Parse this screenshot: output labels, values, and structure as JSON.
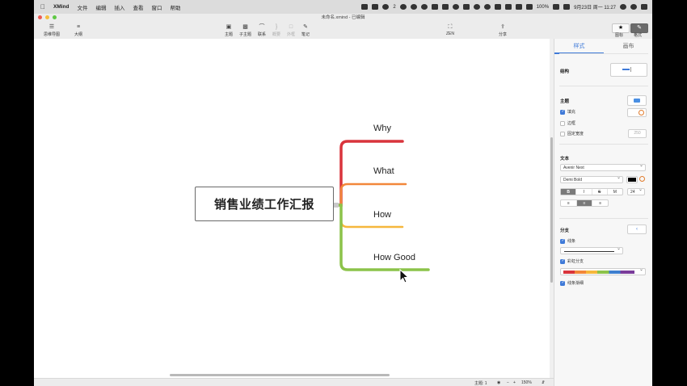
{
  "menubar": {
    "app": "XMind",
    "items": [
      "文件",
      "编辑",
      "插入",
      "查看",
      "窗口",
      "帮助"
    ],
    "wechat_badge": "2",
    "battery": "100%",
    "datetime": "9月23日 周一 11:27"
  },
  "window": {
    "title": "未命名.xmind - 已编辑"
  },
  "toolbar": {
    "left": [
      {
        "label": "思维导图",
        "icon": "mindmap-icon"
      },
      {
        "label": "大纲",
        "icon": "outline-icon"
      }
    ],
    "center": [
      {
        "label": "主题",
        "icon": "topic-icon"
      },
      {
        "label": "子主题",
        "icon": "subtopic-icon"
      },
      {
        "label": "联系",
        "icon": "relationship-icon"
      },
      {
        "label": "概要",
        "icon": "summary-icon"
      },
      {
        "label": "外框",
        "icon": "boundary-icon"
      },
      {
        "label": "笔记",
        "icon": "note-icon"
      }
    ],
    "zen": "ZEN",
    "share": "分享",
    "icon_btn": "图标",
    "format_btn": "格式"
  },
  "mindmap": {
    "central": "销售业绩工作汇报",
    "branches": [
      {
        "label": "Why",
        "color": "#d9343c"
      },
      {
        "label": "What",
        "color": "#f2873a"
      },
      {
        "label": "How",
        "color": "#f6b73c"
      },
      {
        "label": "How Good",
        "color": "#8cc34a"
      }
    ]
  },
  "panel": {
    "tabs": [
      "样式",
      "画布"
    ],
    "structure_label": "结构",
    "topic_label": "主题",
    "fill_label": "填充",
    "border_label": "边框",
    "fixed_width_label": "固定宽度",
    "fixed_width_value": "250",
    "text_label": "文本",
    "font_family": "Avenir Next",
    "font_weight": "Demi Bold",
    "font_size": "24",
    "bold": "B",
    "italic": "I",
    "strike": "S",
    "more": "M",
    "branch_label": "分支",
    "line_label": "线条",
    "rainbow_label": "彩虹分支",
    "taper_label": "线条渐细",
    "fill_color": "#4a8fe3",
    "text_color": "#000000"
  },
  "status": {
    "topic_count": "主题: 1",
    "zoom": "150%"
  }
}
